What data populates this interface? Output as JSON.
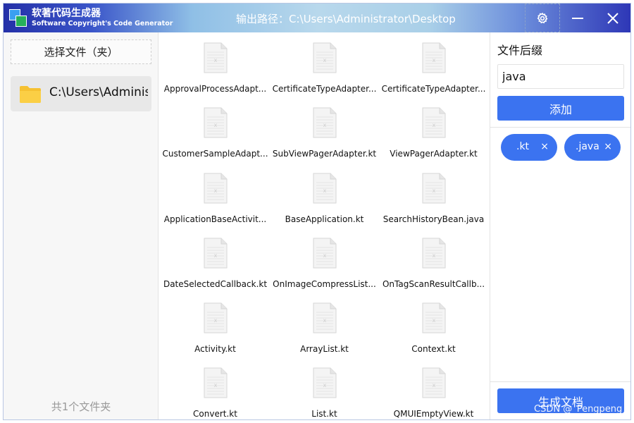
{
  "titlebar": {
    "app_name": "软著代码生成器",
    "app_subtitle": "Software Copyright's Code Generator",
    "output_path": "输出路径：C:\\Users\\Administrator\\Desktop",
    "settings_icon": "gear-icon",
    "minimize_icon": "minimize-icon",
    "close_icon": "close-icon"
  },
  "left_panel": {
    "select_folder_label": "选择文件（夹）",
    "folders": [
      {
        "path": "C:\\Users\\Administrator",
        "icon": "folder-icon",
        "color": "#f6c131"
      }
    ],
    "count_label": "共1个文件夹"
  },
  "files": [
    "ApprovalProcessAdapt...",
    "CertificateTypeAdapter...",
    "CertificateTypeAdapter...",
    "CustomerSampleAdapt...",
    "SubViewPagerAdapter.kt",
    "ViewPagerAdapter.kt",
    "ApplicationBaseActivit...",
    "BaseApplication.kt",
    "SearchHistoryBean.java",
    "DateSelectedCallback.kt",
    "OnImageCompressList...",
    "OnTagScanResultCallb...",
    "Activity.kt",
    "ArrayList.kt",
    "Context.kt",
    "Convert.kt",
    "List.kt",
    "QMUIEmptyView.kt"
  ],
  "right_panel": {
    "suffix_title": "文件后缀",
    "suffix_input_value": "java",
    "add_label": "添加",
    "tags": [
      {
        "label": ".kt",
        "close": "×"
      },
      {
        "label": ".java",
        "close": "×"
      }
    ],
    "generate_label": "生成文档"
  },
  "watermark": "CSDN @_Pengpeng",
  "colors": {
    "accent": "#3b73f0",
    "folder": "#f6c131"
  }
}
